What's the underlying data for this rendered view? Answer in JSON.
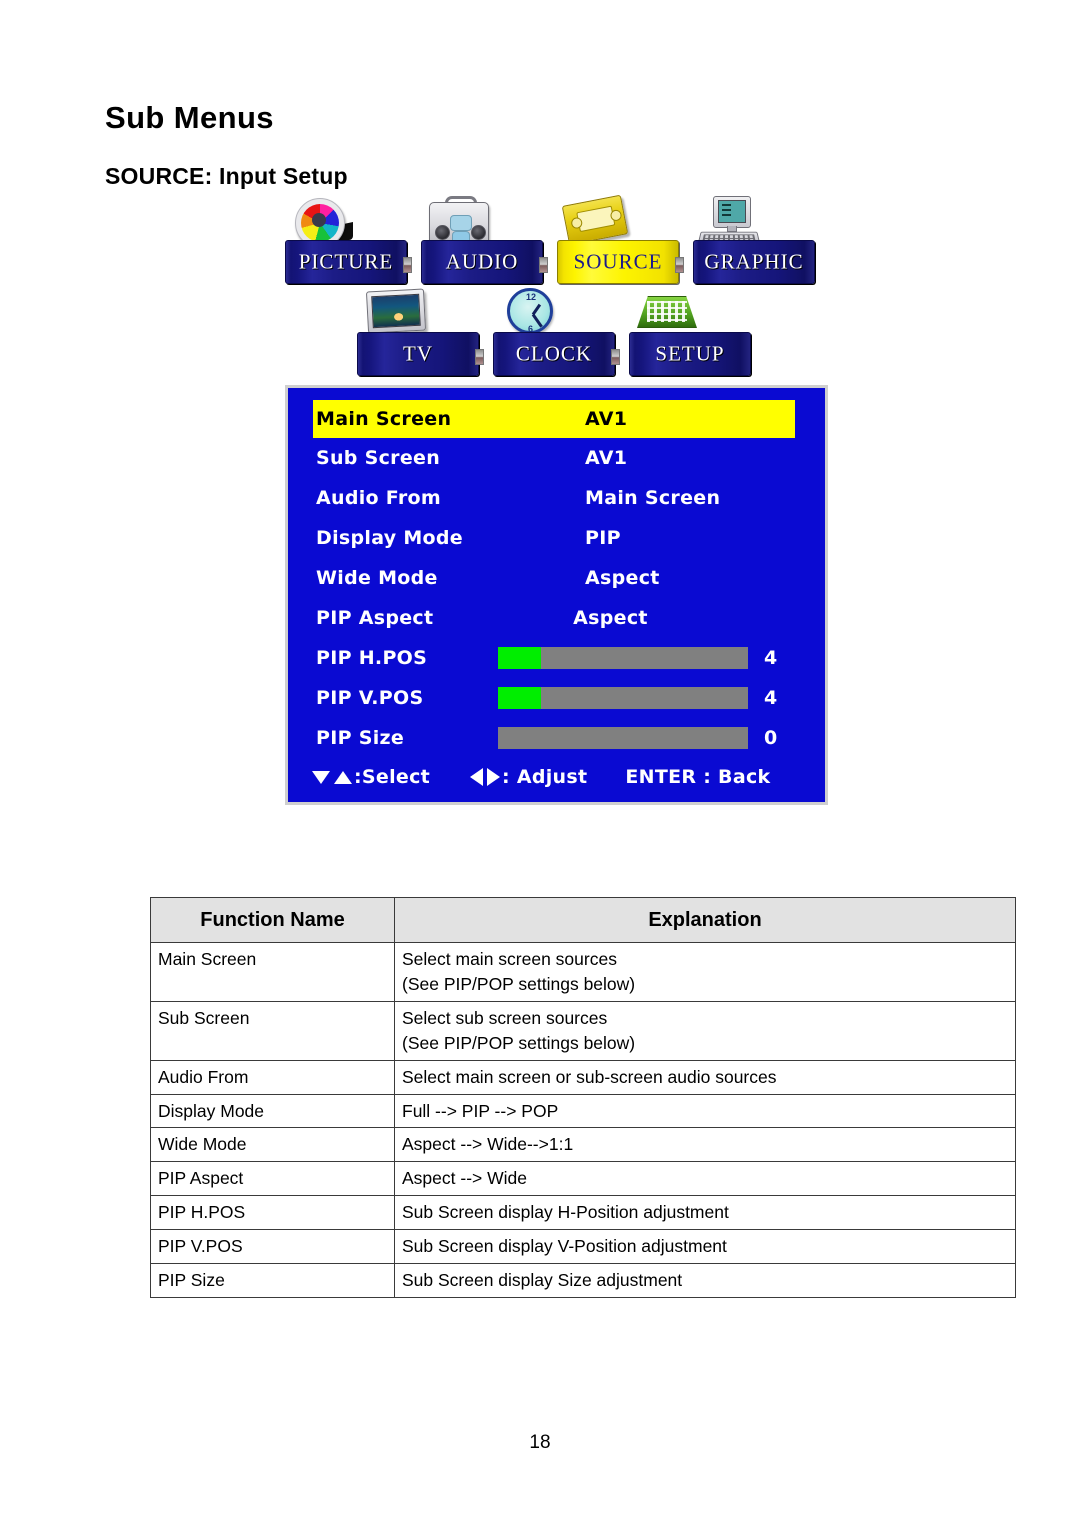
{
  "page": {
    "title": "Sub Menus",
    "section": "SOURCE: Input Setup",
    "number": "18"
  },
  "icon_menu": {
    "row1": [
      {
        "label": "PICTURE",
        "icon": "color-wheel-icon",
        "selected": false
      },
      {
        "label": "AUDIO",
        "icon": "boombox-icon",
        "selected": false
      },
      {
        "label": "SOURCE",
        "icon": "vhs-tape-icon",
        "selected": true
      },
      {
        "label": "GRAPHIC",
        "icon": "computer-icon",
        "selected": false
      }
    ],
    "row2": [
      {
        "label": "TV",
        "icon": "television-icon",
        "selected": false
      },
      {
        "label": "CLOCK",
        "icon": "clock-icon",
        "selected": false
      },
      {
        "label": "SETUP",
        "icon": "keypad-icon",
        "selected": false
      }
    ],
    "colors": {
      "plate_blue": "#1a1a86",
      "plate_yellow": "#fdf400",
      "selected_text": "#1a1a8c"
    }
  },
  "osd": {
    "background": "#0a0ad2",
    "highlight": "#ffff00",
    "bar_track": "#808080",
    "bar_fill": "#00ee00",
    "rows": [
      {
        "label": "Main Screen",
        "value": "AV1",
        "type": "value",
        "highlighted": true
      },
      {
        "label": "Sub Screen",
        "value": "AV1",
        "type": "value",
        "highlighted": false
      },
      {
        "label": "Audio From",
        "value": "Main Screen",
        "type": "value",
        "highlighted": false
      },
      {
        "label": "Display Mode",
        "value": "PIP",
        "type": "value",
        "highlighted": false
      },
      {
        "label": "Wide Mode",
        "value": "Aspect",
        "type": "value",
        "highlighted": false
      },
      {
        "label": "PIP Aspect",
        "value": "Aspect",
        "type": "centered_value",
        "highlighted": false
      },
      {
        "label": "PIP H.POS",
        "value": "4",
        "type": "slider",
        "fill_percent": 17,
        "highlighted": false
      },
      {
        "label": "PIP V.POS",
        "value": "4",
        "type": "slider",
        "fill_percent": 17,
        "highlighted": false
      },
      {
        "label": "PIP Size",
        "value": "0",
        "type": "slider",
        "fill_percent": 0,
        "highlighted": false
      }
    ],
    "footer": {
      "select_label": ":Select",
      "adjust_label": ": Adjust",
      "back_label": "ENTER : Back"
    }
  },
  "function_table": {
    "headers": [
      "Function Name",
      "Explanation"
    ],
    "rows": [
      {
        "name": "Main Screen",
        "explanation": "Select main screen sources",
        "explanation_line2": "(See PIP/POP settings below)"
      },
      {
        "name": "Sub Screen",
        "explanation": "Select sub screen sources",
        "explanation_line2": "(See PIP/POP settings below)"
      },
      {
        "name": "Audio From",
        "explanation": "Select main screen or sub-screen audio sources",
        "explanation_line2": ""
      },
      {
        "name": "Display Mode",
        "explanation": "Full --> PIP --> POP",
        "explanation_line2": ""
      },
      {
        "name": "Wide Mode",
        "explanation": "Aspect --> Wide-->1:1",
        "explanation_line2": ""
      },
      {
        "name": "PIP Aspect",
        "explanation": "Aspect --> Wide",
        "explanation_line2": ""
      },
      {
        "name": "PIP H.POS",
        "explanation": "Sub Screen display H-Position adjustment",
        "explanation_line2": ""
      },
      {
        "name": "PIP V.POS",
        "explanation": "Sub Screen display V-Position adjustment",
        "explanation_line2": ""
      },
      {
        "name": "PIP Size",
        "explanation": "Sub Screen display Size adjustment",
        "explanation_line2": ""
      }
    ]
  }
}
